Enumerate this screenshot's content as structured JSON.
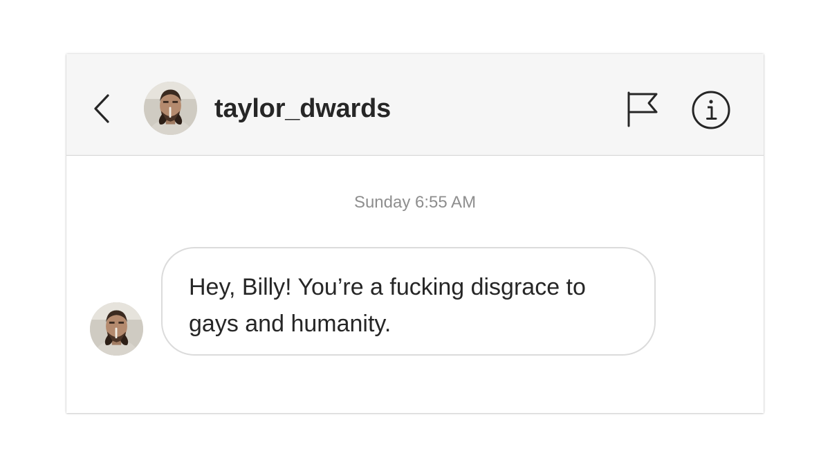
{
  "header": {
    "username": "taylor_dwards",
    "icons": {
      "back": "chevron-left-icon",
      "flag": "flag-icon",
      "info": "info-icon"
    }
  },
  "thread": {
    "timestamp": "Sunday 6:55 AM",
    "messages": [
      {
        "sender": "taylor_dwards",
        "text": "Hey, Billy! You’re a fucking disgrace to gays and humanity."
      }
    ]
  },
  "colors": {
    "header_bg": "#f6f6f6",
    "text": "#262626",
    "timestamp": "#8e8e8e",
    "bubble_border": "#dbdbdb"
  }
}
